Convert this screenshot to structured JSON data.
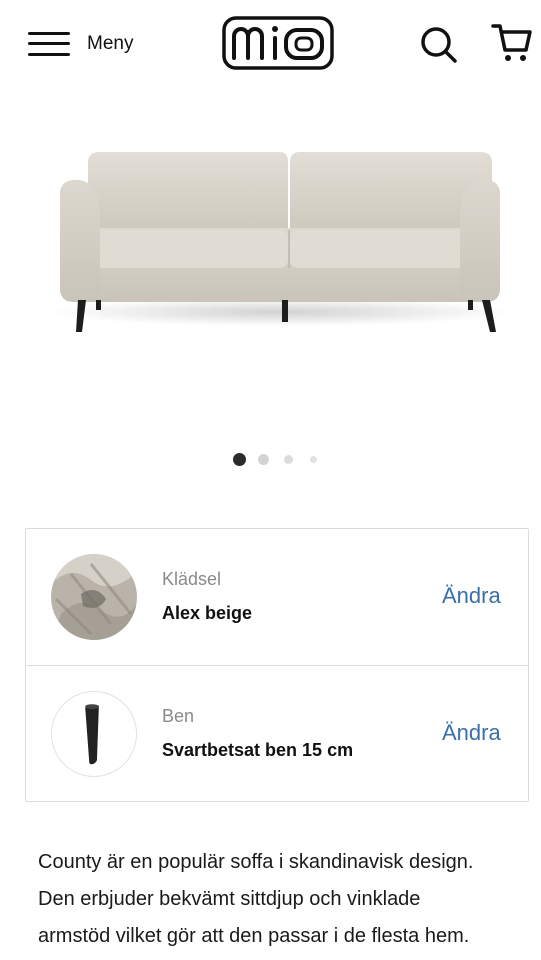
{
  "header": {
    "menu_label": "Meny",
    "logo_text": "MIO",
    "icons": {
      "menu": "hamburger-icon",
      "search": "search-icon",
      "cart": "cart-icon"
    }
  },
  "carousel": {
    "slide_count": 4,
    "active_index": 0
  },
  "options": [
    {
      "label": "Klädsel",
      "value": "Alex beige",
      "action": "Ändra"
    },
    {
      "label": "Ben",
      "value": "Svartbetsat ben 15 cm",
      "action": "Ändra"
    }
  ],
  "description": {
    "lines": [
      "County är en populär soffa i skandinavisk design.",
      "Den erbjuder bekvämt sittdjup och vinklade",
      "armstöd vilket gör att den passar i de flesta hem."
    ]
  },
  "colors": {
    "link": "#3a6fa8",
    "border": "#dcdcdc",
    "sofa_fabric": "#d8d4cb"
  }
}
